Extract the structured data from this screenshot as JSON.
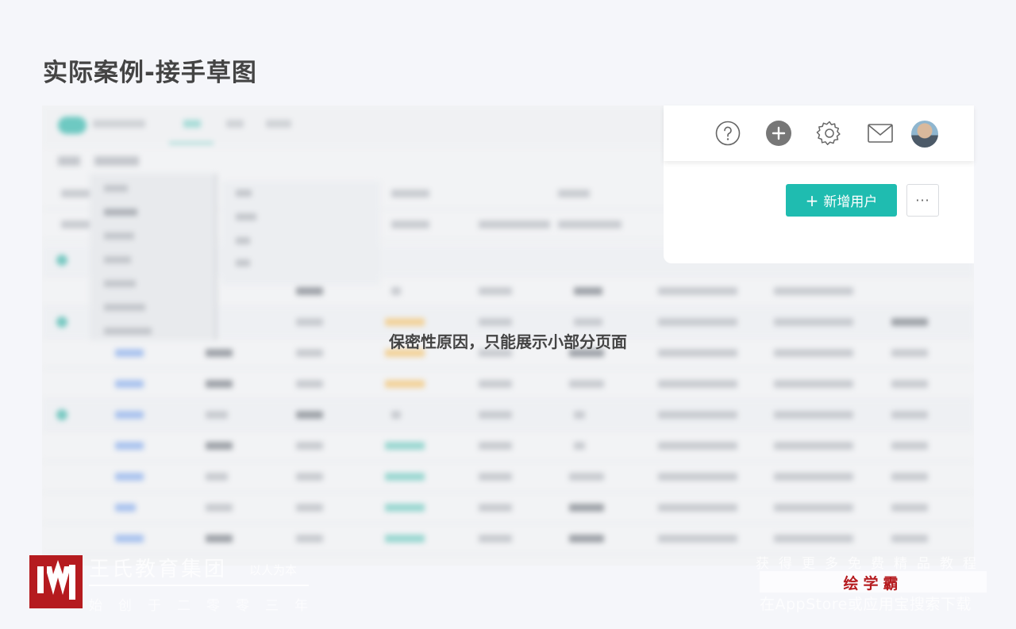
{
  "slide": {
    "title": "实际案例-接手草图",
    "notice": "保密性原因，只能展示小部分页面"
  },
  "header": {
    "icons": [
      "help-icon",
      "add-circle-icon",
      "gear-icon",
      "mail-icon",
      "avatar"
    ]
  },
  "toolbar": {
    "add_user_label": "新增用户",
    "add_user_prefix": "+",
    "more_label": "···"
  },
  "watermark": {
    "org_name": "王氏教育集团",
    "motto": "以人为本",
    "since": "始创于二零零三年",
    "promo_line": "获得更多免费精品教程",
    "brand": "绘学霸",
    "download_line": "在AppStore或应用宝搜索下载"
  },
  "colors": {
    "accent": "#1fbcb0",
    "brand_red": "#b51b1f",
    "background": "#f5f6fa"
  }
}
